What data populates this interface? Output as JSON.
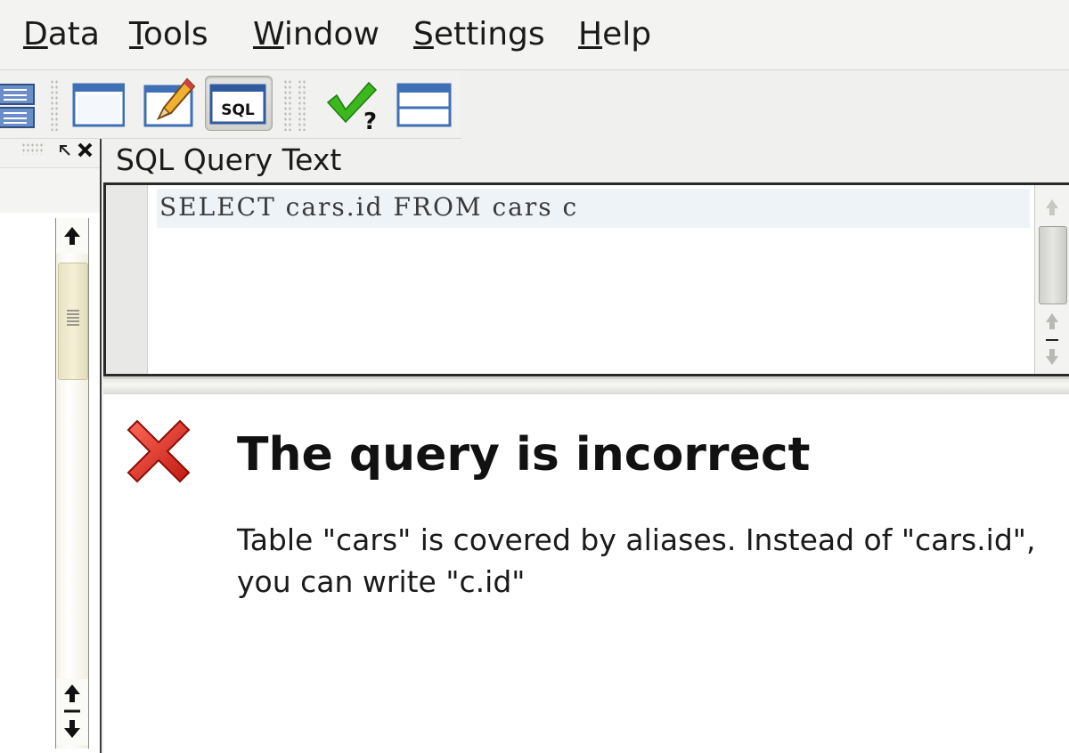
{
  "menu": {
    "items": [
      {
        "label": "Data"
      },
      {
        "label": "Tools"
      },
      {
        "label": "Window"
      },
      {
        "label": "Settings"
      },
      {
        "label": "Help"
      }
    ]
  },
  "toolbar": {
    "buttons": [
      {
        "icon": "table-list-icon"
      },
      {
        "icon": "window-icon"
      },
      {
        "icon": "edit-pencil-icon"
      },
      {
        "icon": "sql-icon",
        "label": "SQL",
        "pressed": true
      },
      {
        "icon": "check-query-icon",
        "label": "?"
      },
      {
        "icon": "panel-layout-icon"
      }
    ]
  },
  "left_panel": {
    "dock_icons": [
      "float-icon",
      "close-icon"
    ]
  },
  "sql_panel": {
    "title": "SQL Query Text",
    "query": "SELECT cars.id FROM cars c"
  },
  "result": {
    "status_icon": "error-x-icon",
    "title": "The query is incorrect",
    "message": "Table \"cars\" is covered by aliases. Instead of \"cars.id\", you can write \"c.id\""
  },
  "colors": {
    "error_red": "#e0302a",
    "check_green": "#3cb81e",
    "icon_blue": "#3f6fb5"
  }
}
